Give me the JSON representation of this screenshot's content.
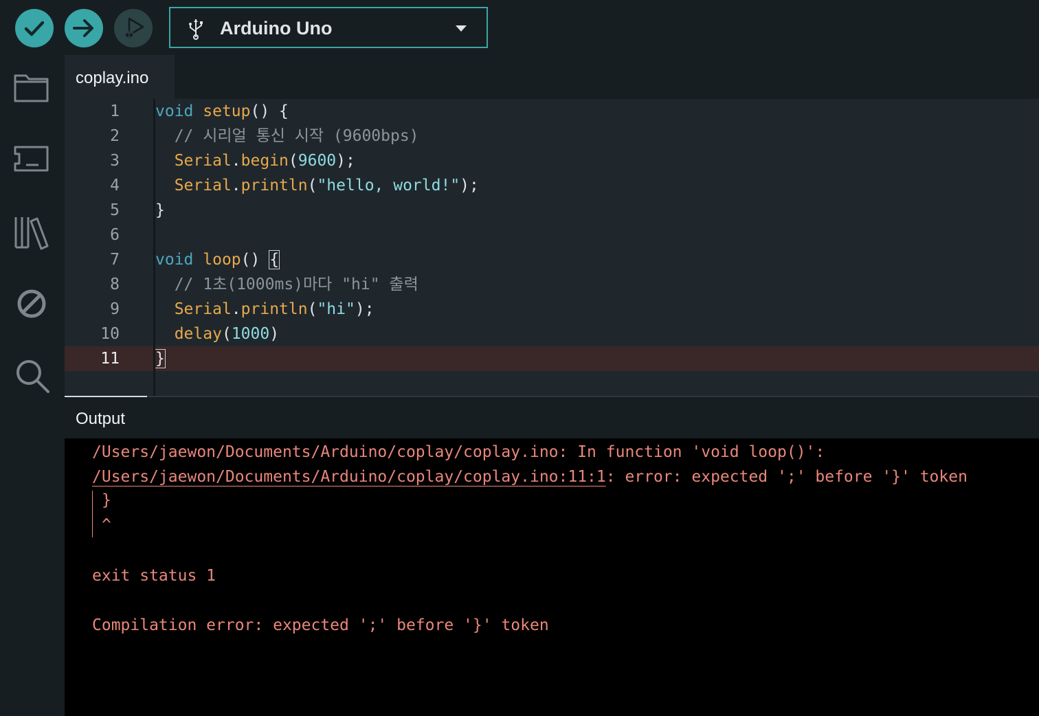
{
  "toolbar": {
    "verify_icon": "check-icon",
    "upload_icon": "arrow-right-icon",
    "debug_icon": "debug-icon",
    "board_name": "Arduino Uno",
    "colors": {
      "accent": "#39a7a8",
      "bg": "#171e21"
    }
  },
  "sidebar": {
    "items": [
      {
        "name": "sketchbook",
        "icon": "folder-icon"
      },
      {
        "name": "boards-manager",
        "icon": "board-icon"
      },
      {
        "name": "library-manager",
        "icon": "library-icon"
      },
      {
        "name": "debug",
        "icon": "no-entry-icon"
      },
      {
        "name": "search",
        "icon": "search-icon"
      }
    ]
  },
  "editor": {
    "tab_label": "coplay.ino",
    "line_numbers": [
      "1",
      "2",
      "3",
      "4",
      "5",
      "6",
      "7",
      "8",
      "9",
      "10",
      "11"
    ],
    "lines": [
      [
        [
          "kw",
          "void"
        ],
        [
          "pl",
          " "
        ],
        [
          "fn",
          "setup"
        ],
        [
          "pl",
          "() {"
        ]
      ],
      [
        [
          "cm",
          "  // 시리얼 통신 시작 (9600bps)"
        ]
      ],
      [
        [
          "pl",
          "  "
        ],
        [
          "fn",
          "Serial"
        ],
        [
          "pl",
          "."
        ],
        [
          "fn",
          "begin"
        ],
        [
          "pl",
          "("
        ],
        [
          "num",
          "9600"
        ],
        [
          "pl",
          ");"
        ]
      ],
      [
        [
          "pl",
          "  "
        ],
        [
          "fn",
          "Serial"
        ],
        [
          "pl",
          "."
        ],
        [
          "fn",
          "println"
        ],
        [
          "pl",
          "("
        ],
        [
          "str",
          "\"hello, world!\""
        ],
        [
          "pl",
          ");"
        ]
      ],
      [
        [
          "pl",
          "}"
        ]
      ],
      [],
      [
        [
          "kw",
          "void"
        ],
        [
          "pl",
          " "
        ],
        [
          "fn",
          "loop"
        ],
        [
          "pl",
          "() "
        ],
        [
          "box",
          "{"
        ]
      ],
      [
        [
          "cm",
          "  // 1초(1000ms)마다 \"hi\" 출력"
        ]
      ],
      [
        [
          "pl",
          "  "
        ],
        [
          "fn",
          "Serial"
        ],
        [
          "pl",
          "."
        ],
        [
          "fn",
          "println"
        ],
        [
          "pl",
          "("
        ],
        [
          "str",
          "\"hi\""
        ],
        [
          "pl",
          ");"
        ]
      ],
      [
        [
          "pl",
          "  "
        ],
        [
          "fn",
          "delay"
        ],
        [
          "pl",
          "("
        ],
        [
          "num",
          "1000"
        ],
        [
          "pl",
          ")"
        ]
      ],
      [
        [
          "cursor",
          ""
        ],
        [
          "box",
          "}"
        ]
      ]
    ],
    "current_line": 11
  },
  "output": {
    "label": "Output",
    "lines": {
      "l1": "/Users/jaewon/Documents/Arduino/coplay/coplay.ino: In function 'void loop()':",
      "l2_link": "/Users/jaewon/Documents/Arduino/coplay/coplay.ino:11:1",
      "l2_rest": ": error: expected ';' before '}' token",
      "l3": "}",
      "l4": "^",
      "l5": "exit status 1",
      "l6": "Compilation error: expected ';' before '}' token"
    },
    "error_color": "#e9877a"
  }
}
